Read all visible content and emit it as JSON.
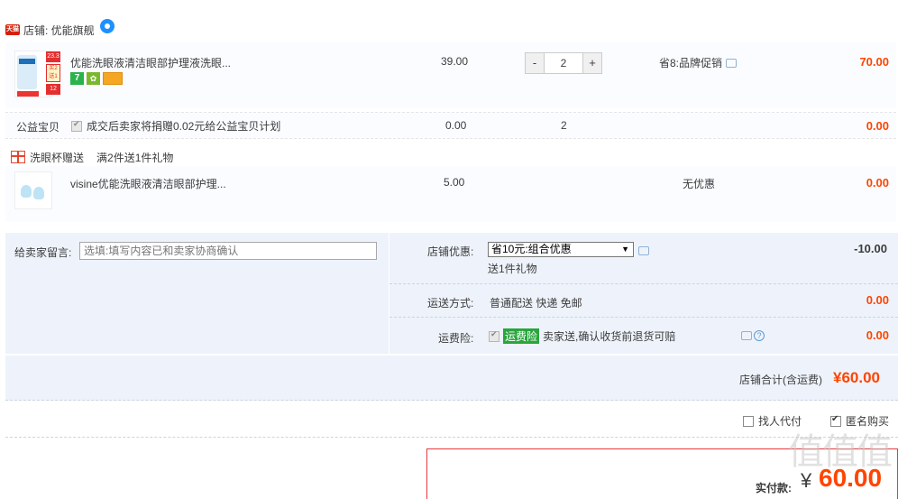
{
  "shop": {
    "badge": "天猫",
    "label": "店铺: 优能旗舰",
    "ww_icon": "wangwang-chat-icon"
  },
  "item1": {
    "title": "优能洗眼液清洁眼部护理液洗眼...",
    "thumb_badges": [
      "23.3",
      "买2送1",
      "12"
    ],
    "service_icons": [
      "seven-day-return-icon",
      "guarantee-icon",
      "card-icon"
    ],
    "price": "39.00",
    "qty": "2",
    "qty_minus": "-",
    "qty_plus": "+",
    "promo": "省8:品牌促销",
    "subtotal": "70.00"
  },
  "charity": {
    "label": "公益宝贝",
    "text": "成交后卖家将捐赠0.02元给公益宝贝计划",
    "price": "0.00",
    "qty": "2",
    "subtotal": "0.00"
  },
  "gift": {
    "name": "洗眼杯赠送",
    "rule": "满2件送1件礼物"
  },
  "item2": {
    "title": "visine优能洗眼液清洁眼部护理...",
    "price": "5.00",
    "promo": "无优惠",
    "subtotal": "0.00"
  },
  "message": {
    "label": "给卖家留言:",
    "placeholder": "选填:填写内容已和卖家协商确认"
  },
  "shop_discount": {
    "label": "店铺优惠:",
    "selected": "省10元:组合优惠",
    "sub": "送1件礼物",
    "amount": "-10.00"
  },
  "shipping": {
    "label": "运送方式:",
    "value": "普通配送 快递 免邮",
    "amount": "0.00"
  },
  "insurance": {
    "label": "运费险:",
    "tag": "运费险",
    "text": "卖家送,确认收货前退货可赔",
    "amount": "0.00"
  },
  "shop_total": {
    "label": "店铺合计(含运费)",
    "value": "¥60.00"
  },
  "options": {
    "proxy_pay": "找人代付",
    "anonymous": "匿名购买"
  },
  "payment": {
    "label": "实付款:",
    "currency": "¥",
    "value": "60.00"
  },
  "watermark": "值值值",
  "colors": {
    "accent_red": "#ff4400",
    "row_bg": "#eef3fb",
    "pay_border": "#e4393c"
  }
}
